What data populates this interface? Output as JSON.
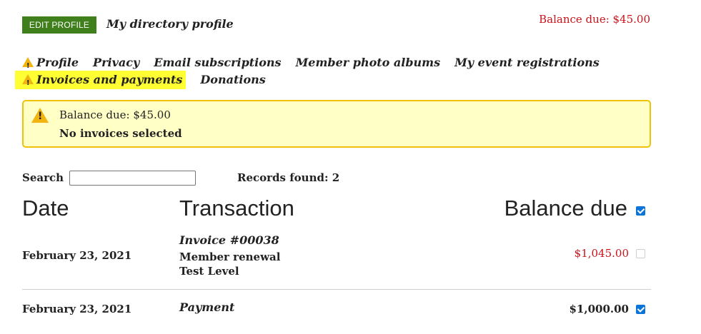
{
  "header": {
    "edit_profile_label": "EDIT PROFILE",
    "directory_link": "My directory profile",
    "balance_due": "Balance due: $45.00"
  },
  "nav": {
    "items": [
      {
        "label": "Profile",
        "warning": true
      },
      {
        "label": "Privacy",
        "warning": false
      },
      {
        "label": "Email subscriptions",
        "warning": false
      },
      {
        "label": "Member photo albums",
        "warning": false
      },
      {
        "label": "My event registrations",
        "warning": false
      },
      {
        "label": "Invoices and payments",
        "warning": true,
        "active": true
      },
      {
        "label": "Donations",
        "warning": false
      }
    ]
  },
  "alert": {
    "balance": "Balance due: $45.00",
    "message": "No invoices selected"
  },
  "search": {
    "label": "Search",
    "value": "",
    "records_label": "Records found: 2"
  },
  "table": {
    "headers": [
      "Date",
      "Transaction",
      "Balance due"
    ],
    "header_checkbox_checked": true,
    "rows": [
      {
        "date": "February 23, 2021",
        "transaction_title": "Invoice #00038",
        "lines": [
          "Member renewal",
          "Test Level"
        ],
        "amount": "$1,045.00",
        "checked": false
      },
      {
        "date": "February 23, 2021",
        "transaction_title": "Payment",
        "lines": [],
        "amount": "$1,000.00",
        "checked": true
      }
    ]
  },
  "colors": {
    "accent_green": "#3f7f1c",
    "alert_red": "#c8141c",
    "highlight_yellow": "#ffff33",
    "alert_bg": "#ffffc6"
  }
}
